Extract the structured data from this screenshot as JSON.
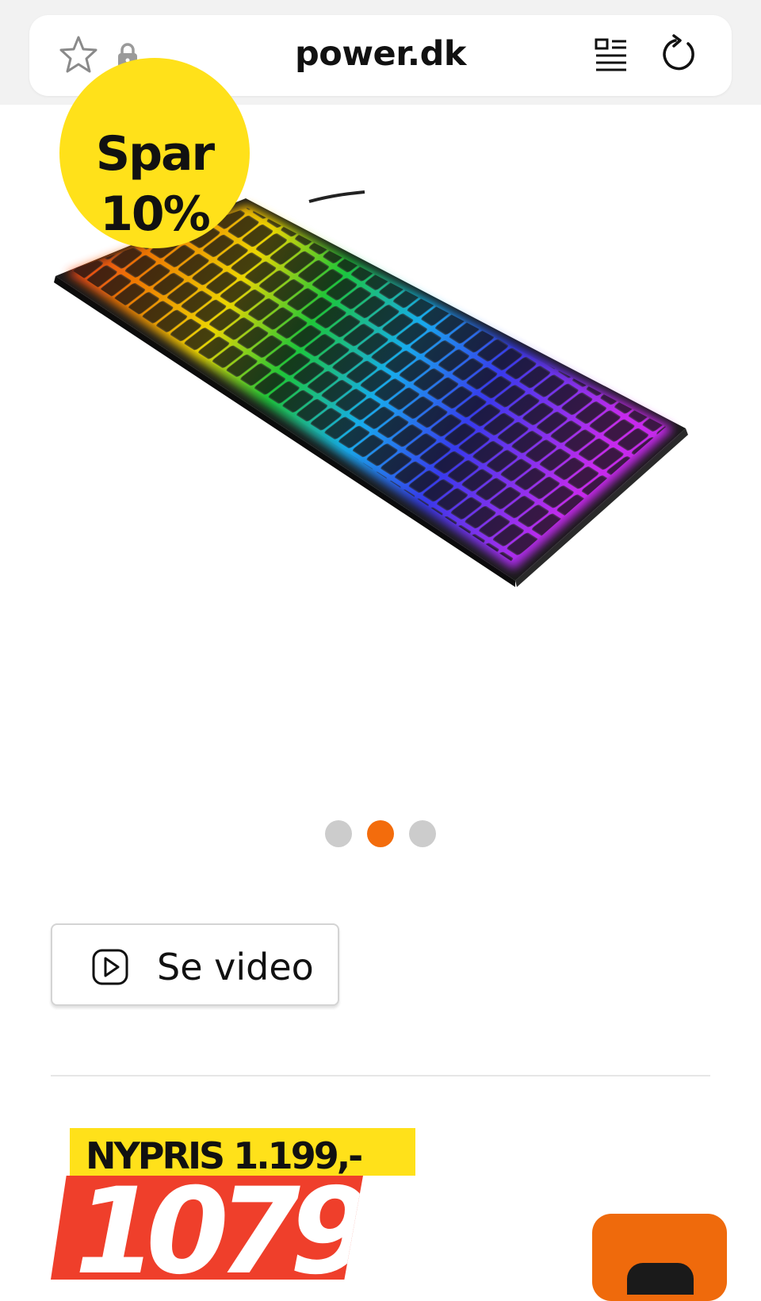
{
  "browser": {
    "url": "power.dk",
    "icons": [
      "star-icon",
      "lock-icon",
      "reader-view-icon",
      "reload-icon"
    ]
  },
  "product": {
    "badge_line1": "Spar",
    "badge_line2": "10%",
    "image": "rgb-mechanical-keyboard",
    "carousel": {
      "total": 3,
      "active": 2
    },
    "video_button_label": "Se video",
    "new_price_label": "NYPRIS 1.199,-",
    "price": "1079"
  },
  "colors": {
    "accent": "#f36c0c",
    "badge": "#ffe11a",
    "price_bg": "#ef3f2b"
  }
}
